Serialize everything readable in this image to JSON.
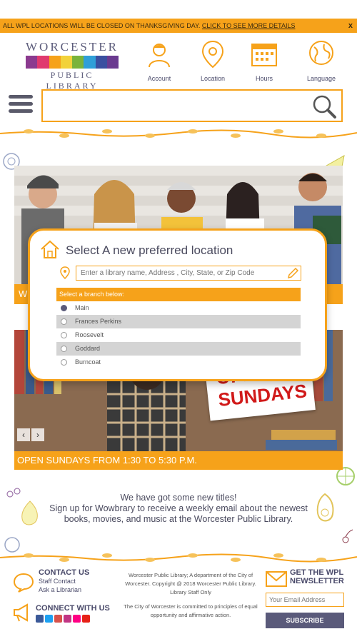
{
  "alert": {
    "text": "ALL WPL LOCATIONS WILL BE CLOSED ON THANKSGIVING DAY. ",
    "link": "CLICK TO SEE MORE DETAILS",
    "close": "x"
  },
  "logo": {
    "top": "WORCESTER",
    "bottom": "PUBLIC LIBRARY"
  },
  "utility_nav": [
    {
      "label": "Account",
      "icon": "account-icon"
    },
    {
      "label": "Location",
      "icon": "location-icon"
    },
    {
      "label": "Hours",
      "icon": "calendar-icon"
    },
    {
      "label": "Language",
      "icon": "globe-icon"
    }
  ],
  "search": {
    "placeholder": ""
  },
  "hero": {
    "caption": "W"
  },
  "promo_slide": {
    "sign": "OPEN SUNDAYS",
    "caption": "OPEN SUNDAYS FROM 1:30 TO 5:30 P.M."
  },
  "modal": {
    "title": "Select A new preferred location",
    "input_placeholder": "Enter a library name, Address , City, State, or Zip Code",
    "branch_header": "Select a branch below:",
    "branches": [
      "Main",
      "Frances Perkins",
      "Roosevelt",
      "Goddard",
      "Burncoat"
    ],
    "selected": "Main"
  },
  "promo": {
    "line1": "We have got some new titles!",
    "line2": "Sign up for Wowbrary to receive a weekly email about the newest",
    "line3": "books, movies, and music at the Worcester Public Library."
  },
  "footer": {
    "contact_title": "CONTACT US",
    "contact_links": [
      "Staff Contact",
      "Ask a Librarian"
    ],
    "connect_title": "CONNECT WITH US",
    "info1": "Worcester Public Library; A department of the City of Worcester. Copyright @ 2018 Worcester Public Library. Library Staff Only",
    "info2": "The City of Worcester is committed to principles of equal opportunity and affirmative action.",
    "newsletter_title_1": "GET THE WPL",
    "newsletter_title_2": "NEWSLETTER",
    "email_placeholder": "Your Email Address",
    "subscribe": "SUBSCRIBE"
  },
  "colors": {
    "accent": "#f6a21a",
    "text": "#4a4a5e",
    "button": "#5a5a7a"
  }
}
